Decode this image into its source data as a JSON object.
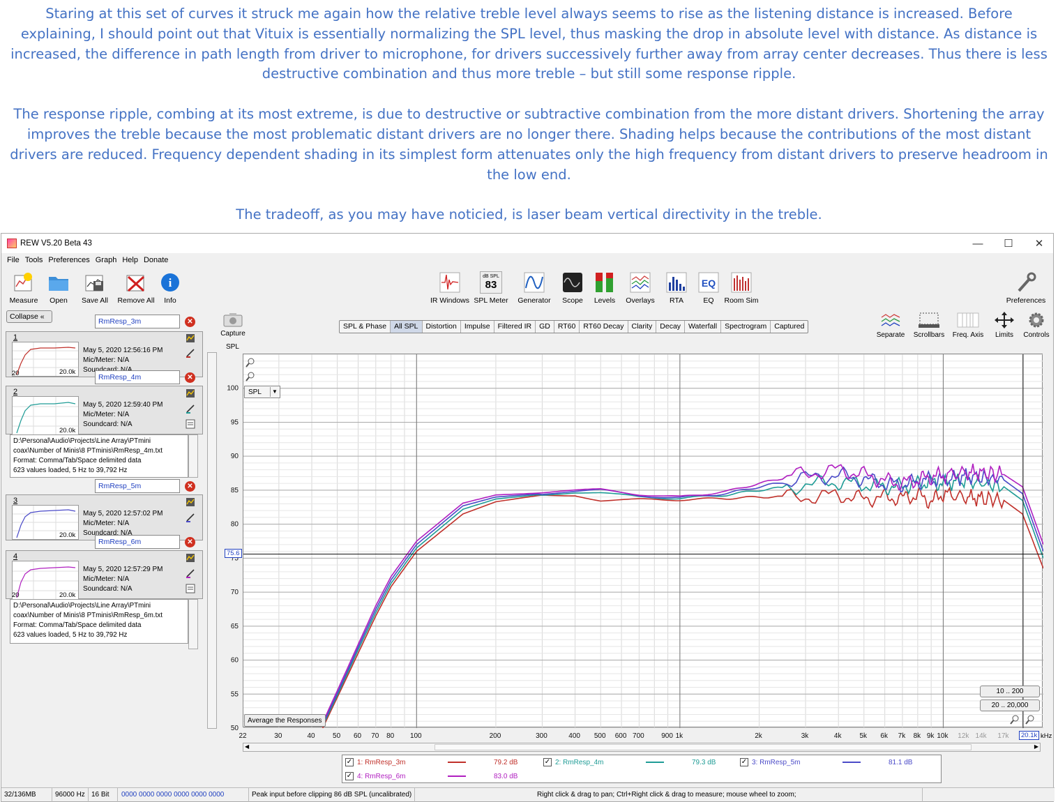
{
  "caption": {
    "p1": "Staring at this set of curves it struck me again how the relative treble level always seems to rise as the listening distance is increased. Before explaining, I should point out that Vituix is essentially normalizing the SPL level, thus masking the drop in absolute level with distance.  As distance is increased, the difference in path length from driver to microphone, for drivers successively further away from array center decreases.  Thus there is less destructive combination and thus more treble – but still some response ripple.",
    "p2": "The response ripple, combing at its most extreme, is due to destructive or subtractive combination from the more distant drivers.  Shortening the array improves the treble because the most problematic distant drivers are no longer there.   Shading helps because the contributions of the most distant drivers are reduced.  Frequency dependent shading in its simplest form attenuates only the high frequency from distant drivers to preserve headroom in the low end.",
    "p3": "The tradeoff, as you may have noticied, is laser beam vertical directivity in the treble."
  },
  "window": {
    "title": "REW V5.20 Beta 43",
    "controls": {
      "minimize": "—",
      "maximize": "☐",
      "close": "✕"
    }
  },
  "menu": [
    "File",
    "Tools",
    "Preferences",
    "Graph",
    "Help",
    "Donate"
  ],
  "toolbar_left": [
    {
      "label": "Measure",
      "icon": "measure-icon"
    },
    {
      "label": "Open",
      "icon": "folder-icon"
    },
    {
      "label": "Save All",
      "icon": "save-all-icon"
    },
    {
      "label": "Remove All",
      "icon": "remove-all-icon"
    },
    {
      "label": "Info",
      "icon": "info-icon"
    }
  ],
  "toolbar_center": [
    {
      "label": "IR Windows",
      "icon": "ir-windows-icon"
    },
    {
      "label": "SPL Meter",
      "icon": "spl-meter-icon",
      "meter_top": "dB SPL",
      "meter_value": "83"
    },
    {
      "label": "Generator",
      "icon": "generator-icon"
    },
    {
      "label": "Scope",
      "icon": "scope-icon"
    },
    {
      "label": "Levels",
      "icon": "levels-icon"
    },
    {
      "label": "Overlays",
      "icon": "overlays-icon"
    },
    {
      "label": "RTA",
      "icon": "rta-icon"
    },
    {
      "label": "EQ",
      "icon": "eq-icon"
    },
    {
      "label": "Room Sim",
      "icon": "room-sim-icon"
    }
  ],
  "preferences_label": "Preferences",
  "collapse_label": "Collapse",
  "measurements": [
    {
      "num": "1",
      "name": "RmResp_3m",
      "date": "May 5, 2020 12:56:16 PM",
      "mic": "Mic/Meter: N/A",
      "soundcard": "Soundcard: N/A",
      "color": "#c0302a",
      "thumb_lo": "20",
      "thumb_hi": "20.0k"
    },
    {
      "num": "2",
      "name": "RmResp_4m",
      "date": "May 5, 2020 12:59:40 PM",
      "mic": "Mic/Meter: N/A",
      "soundcard": "Soundcard: N/A",
      "color": "#1f9c96",
      "thumb_lo": "20",
      "thumb_hi": "20.0k"
    },
    {
      "num": "3",
      "name": "RmResp_5m",
      "date": "May 5, 2020 12:57:02 PM",
      "mic": "Mic/Meter: N/A",
      "soundcard": "Soundcard: N/A",
      "color": "#4a4ac8",
      "thumb_lo": "20",
      "thumb_hi": "20.0k"
    },
    {
      "num": "4",
      "name": "RmResp_6m",
      "date": "May 5, 2020 12:57:29 PM",
      "mic": "Mic/Meter: N/A",
      "soundcard": "Soundcard: N/A",
      "color": "#b01fc0",
      "thumb_lo": "20",
      "thumb_hi": "20.0k"
    }
  ],
  "notes_4m": [
    "D:\\Personal\\Audio\\Projects\\Line Array\\PTmini",
    "coax\\Number of Minis\\8 PTminis\\RmResp_4m.txt",
    "Format: Comma/Tab/Space delimited data",
    "623 values loaded, 5 Hz to 39,792 Hz"
  ],
  "notes_6m": [
    "D:\\Personal\\Audio\\Projects\\Line Array\\PTmini",
    "coax\\Number of Minis\\8 PTminis\\RmResp_6m.txt",
    "Format: Comma/Tab/Space delimited data",
    "623 values loaded, 5 Hz to 39,792 Hz"
  ],
  "capture_label": "Capture",
  "graph_tabs": [
    "SPL & Phase",
    "All SPL",
    "Distortion",
    "Impulse",
    "Filtered IR",
    "GD",
    "RT60",
    "RT60 Decay",
    "Clarity",
    "Decay",
    "Waterfall",
    "Spectrogram",
    "Captured"
  ],
  "selected_tab": "All SPL",
  "right_tools": [
    {
      "label": "Separate",
      "icon": "separate-icon"
    },
    {
      "label": "Scrollbars",
      "icon": "scrollbars-icon"
    },
    {
      "label": "Freq. Axis",
      "icon": "freq-axis-icon"
    },
    {
      "label": "Limits",
      "icon": "limits-icon"
    },
    {
      "label": "Controls",
      "icon": "controls-gear-icon"
    }
  ],
  "spl_axis_label": "SPL",
  "spl_select": "SPL",
  "cursor_value": "75.6",
  "avg_button": "Average the Responses",
  "range_buttons": [
    "10 .. 200",
    "20 .. 20,000"
  ],
  "cursor_freq_label": "20.1k",
  "khz_label": "kHz",
  "chart_data": {
    "type": "line",
    "xlabel": "",
    "ylabel": "SPL",
    "x_scale": "log",
    "xlim": [
      22,
      24000
    ],
    "ylim": [
      50,
      105
    ],
    "y_ticks": [
      50,
      55,
      60,
      65,
      70,
      75,
      80,
      85,
      90,
      95,
      100
    ],
    "x_tick_labels": [
      "22",
      "30",
      "40",
      "50",
      "60",
      "70",
      "80",
      "100",
      "200",
      "300",
      "400",
      "500",
      "600",
      "700",
      "900",
      "1k",
      "2k",
      "3k",
      "4k",
      "5k",
      "6k",
      "7k",
      "8k",
      "9k",
      "10k",
      "12k",
      "14k",
      "17k",
      "20.1k"
    ],
    "x_tick_values": [
      22,
      30,
      40,
      50,
      60,
      70,
      80,
      100,
      200,
      300,
      400,
      500,
      600,
      700,
      900,
      1000,
      2000,
      3000,
      4000,
      5000,
      6000,
      7000,
      8000,
      9000,
      10000,
      12000,
      14000,
      17000,
      20100
    ],
    "cursor": {
      "freq": 20100,
      "spl": 75.6
    },
    "grid": true,
    "x": [
      44,
      50,
      60,
      70,
      80,
      100,
      150,
      200,
      300,
      400,
      500,
      700,
      1000,
      1500,
      2000,
      3000,
      4000,
      5000,
      6000,
      7000,
      8000,
      9000,
      10000,
      12000,
      14000,
      17000,
      20000,
      24000
    ],
    "series": [
      {
        "name": "1: RmResp_3m",
        "color": "#c0302a",
        "level": "79.2 dB",
        "values": [
          50,
          54.5,
          61,
          66.5,
          70.8,
          76,
          81.5,
          83.3,
          84.3,
          84.3,
          83.5,
          83.6,
          83.6,
          83.8,
          84.0,
          84.0,
          84.3,
          83.7,
          84.0,
          83.8,
          84.3,
          83.3,
          84.5,
          84.0,
          83.8,
          83.5,
          81.5,
          73.5
        ]
      },
      {
        "name": "2: RmResp_4m",
        "color": "#1f9c96",
        "level": "79.3 dB",
        "values": [
          50.3,
          54.8,
          61.5,
          67,
          71.3,
          76.5,
          82.2,
          83.7,
          84.4,
          84.7,
          84.6,
          84.0,
          83.8,
          84.3,
          85.0,
          85.8,
          86.2,
          85.8,
          85.5,
          85.6,
          86.0,
          86.2,
          86.0,
          86.4,
          86.0,
          85.5,
          83.5,
          75.0
        ]
      },
      {
        "name": "3: RmResp_5m",
        "color": "#4a4ac8",
        "level": "81.1 dB",
        "values": [
          50.5,
          55.1,
          61.9,
          67.5,
          71.8,
          77,
          82.7,
          84.0,
          84.5,
          84.8,
          85.0,
          84.2,
          83.9,
          84.5,
          85.5,
          86.8,
          87.2,
          86.6,
          86.0,
          85.8,
          86.3,
          86.6,
          86.5,
          87.0,
          86.8,
          86.5,
          84.5,
          76.0
        ]
      },
      {
        "name": "4: RmResp_6m",
        "color": "#b01fc0",
        "level": "83.0 dB",
        "values": [
          50.8,
          55.5,
          62.3,
          68,
          72.3,
          77.5,
          83.1,
          84.3,
          84.6,
          84.9,
          85.1,
          84.4,
          84.0,
          84.8,
          86.0,
          87.5,
          88.0,
          87.3,
          86.4,
          86.0,
          86.5,
          87.0,
          87.2,
          87.6,
          87.6,
          87.3,
          85.5,
          77.0
        ]
      }
    ]
  },
  "status": {
    "memory": "32/136MB",
    "rate": "96000 Hz",
    "bits": "16 Bit",
    "levels": "0000 0000  0000 0000  0000 0000",
    "peak": "Peak input before clipping 86 dB SPL (uncalibrated)",
    "hint": "Right click & drag to pan; Ctrl+Right click & drag to measure; mouse wheel to zoom;"
  }
}
